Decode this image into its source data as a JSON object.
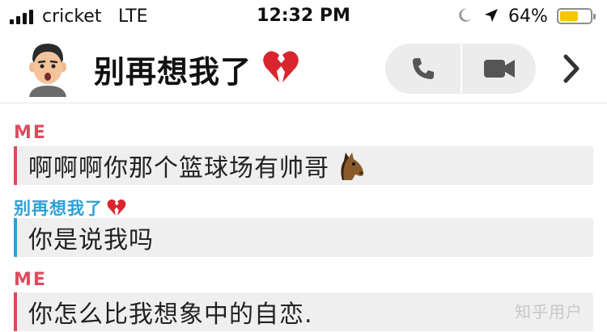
{
  "status_bar": {
    "carrier": "cricket",
    "network": "LTE",
    "time": "12:32 PM",
    "battery_percent": "64%",
    "battery_level": 0.62,
    "battery_color": "#f7c600",
    "icons": [
      "signal-bars",
      "moon-icon",
      "location-arrow-icon",
      "battery-icon"
    ]
  },
  "header": {
    "title": "别再想我了",
    "title_icon": "broken-heart",
    "buttons": [
      "phone-icon",
      "video-camera-icon",
      "chevron-right-icon"
    ]
  },
  "messages": [
    {
      "sender": "ME",
      "sender_color": "#e04a5c",
      "text": "啊啊啊你那个篮球场有帅哥",
      "emoji": "horse-face"
    },
    {
      "sender": "别再想我了",
      "sender_icon": "broken-heart",
      "sender_color": "#2c9fd8",
      "text": "你是说我吗"
    },
    {
      "sender": "ME",
      "sender_color": "#e04a5c",
      "text": "你怎么比我想象中的自恋."
    }
  ],
  "watermark": "知乎用户"
}
